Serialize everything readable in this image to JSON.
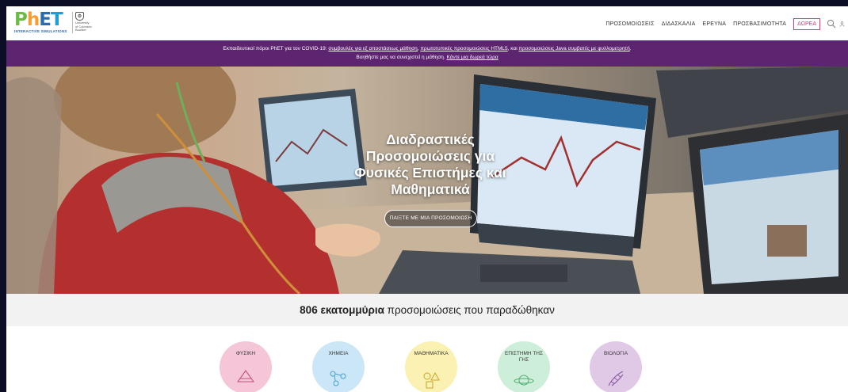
{
  "header": {
    "logo": {
      "name": "PhET",
      "letters": [
        "P",
        "h",
        "E",
        "T"
      ],
      "tagline": "INTERACTIVE SIMULATIONS"
    },
    "partner": {
      "name": "University of Colorado Boulder",
      "lines": [
        "University",
        "of Colorado",
        "Boulder"
      ]
    },
    "nav": [
      "ΠΡΟΣΟΜΟΙΩΣΕΙΣ",
      "ΔΙΔΑΣΚΑΛΙΑ",
      "ΕΡΕΥΝΑ",
      "ΠΡΟΣΒΑΣΙΜΟΤΗΤΑ"
    ],
    "donate": "ΔΩΡΕΑ",
    "icons": [
      "search-icon",
      "user-icon"
    ]
  },
  "banner": {
    "intro": "Εκπαιδευτικοί πόροι PhET για τον COVID-19: ",
    "link1": "συμβουλές για εξ αποστάσεως μάθηση",
    "sep1": ", ",
    "link2": "πρωτοτυπικές προσομοιώσεις HTML5",
    "sep2": ", και ",
    "link3": "προσομοιώσεις Java συμβατές με φυλλομετρητή",
    "end": ".",
    "line2_text": "Βοηθήστε μας να συνεχιστεί η μάθηση. ",
    "line2_link": "Κάντε μια δωρεά τώρα"
  },
  "hero": {
    "title": "Διαδραστικές Προσομοιώσεις για Φυσικές Επιστήμες και Μαθηματικά",
    "button": "ΠΑΙΞΤΕ ΜΕ ΜΙΑ ΠΡΟΣΟΜΟΙΩΣΗ"
  },
  "stats": {
    "bold": "806 εκατομμύρια",
    "rest": " προσομοιώσεις που παραδώθηκαν"
  },
  "subjects": [
    {
      "label": "ΦΥΣΙΚΗ",
      "color": "#f4c6d8",
      "icon": "triangle-icon"
    },
    {
      "label": "ΧΗΜΕΙΑ",
      "color": "#cbe6f6",
      "icon": "molecule-icon"
    },
    {
      "label": "ΜΑΘΗΜΑΤΙΚΑ",
      "color": "#faf1b3",
      "icon": "shapes-icon"
    },
    {
      "label": "ΕΠΙΣΤΗΜΗ ΤΗΣ ΓΗΣ",
      "color": "#cdeed8",
      "icon": "planet-icon"
    },
    {
      "label": "ΒΙΟΛΟΓΙΑ",
      "color": "#e0c9e6",
      "icon": "dna-icon"
    }
  ],
  "colors": {
    "banner": "#5d2470",
    "donate": "#e0337a",
    "stats_bg": "#f2f2f2"
  }
}
